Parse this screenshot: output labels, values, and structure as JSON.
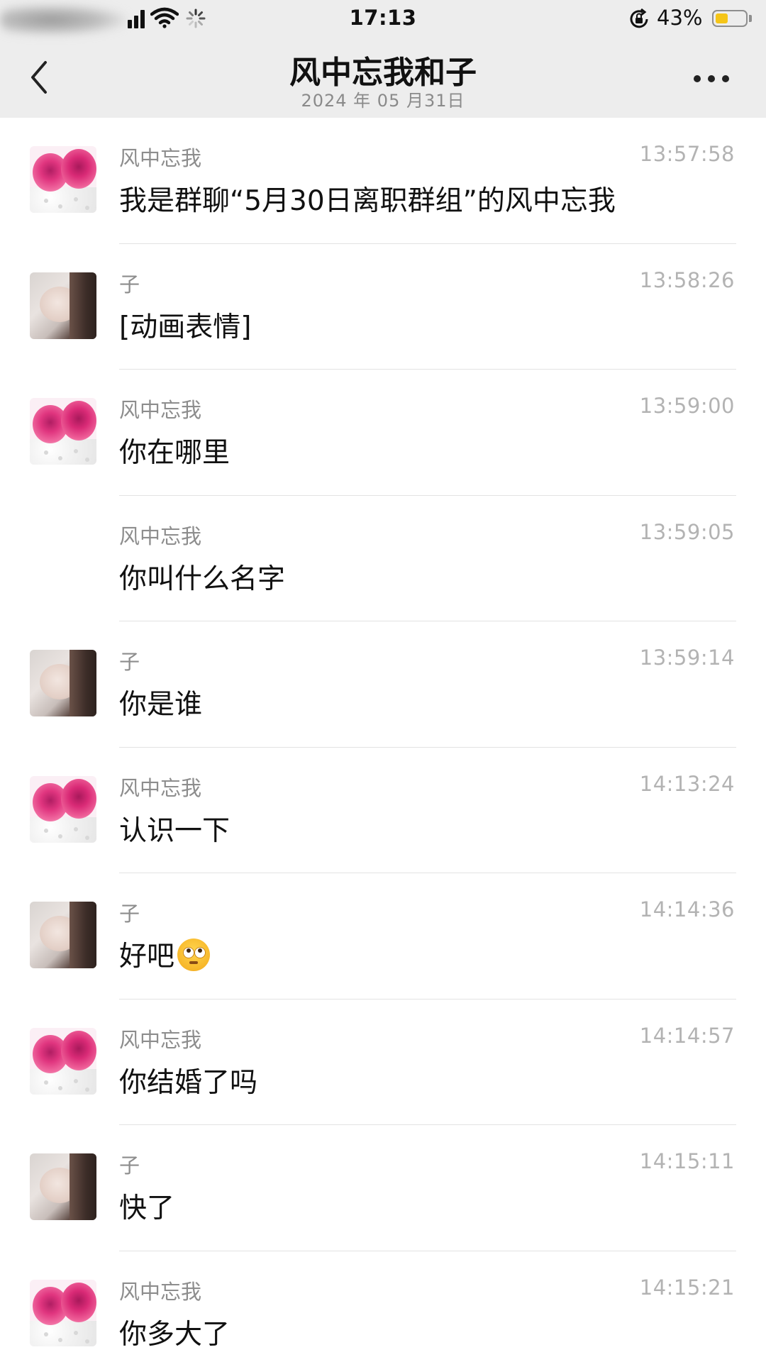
{
  "status_bar": {
    "time": "17:13",
    "battery_percent_text": "43%",
    "battery_level": 0.43,
    "battery_color": "#f5c518",
    "icons": [
      "signal-icon",
      "wifi-icon",
      "loading-spinner-icon",
      "rotation-lock-icon",
      "battery-icon"
    ]
  },
  "nav": {
    "title": "风中忘我和子",
    "subtitle": "2024 年 05 月31日",
    "back_icon": "chevron-left-icon",
    "more_icon": "ellipsis-icon"
  },
  "messages": [
    {
      "sender": "风中忘我",
      "time": "13:57:58",
      "text": "我是群聊“5月30日离职群组”的风中忘我",
      "avatar": "rose"
    },
    {
      "sender": "子",
      "time": "13:58:26",
      "text": "[动画表情]",
      "avatar": "woman"
    },
    {
      "sender": "风中忘我",
      "time": "13:59:00",
      "text": "你在哪里",
      "avatar": "rose"
    },
    {
      "sender": "风中忘我",
      "time": "13:59:05",
      "text": "你叫什么名字",
      "avatar": "none"
    },
    {
      "sender": "子",
      "time": "13:59:14",
      "text": "你是谁",
      "avatar": "woman"
    },
    {
      "sender": "风中忘我",
      "time": "14:13:24",
      "text": "认识一下",
      "avatar": "rose"
    },
    {
      "sender": "子",
      "time": "14:14:36",
      "text": "好吧",
      "emoji": "face-with-rolling-eyes-icon",
      "avatar": "woman"
    },
    {
      "sender": "风中忘我",
      "time": "14:14:57",
      "text": "你结婚了吗",
      "avatar": "rose"
    },
    {
      "sender": "子",
      "time": "14:15:11",
      "text": "快了",
      "avatar": "woman"
    },
    {
      "sender": "风中忘我",
      "time": "14:15:21",
      "text": "你多大了",
      "avatar": "rose"
    }
  ]
}
